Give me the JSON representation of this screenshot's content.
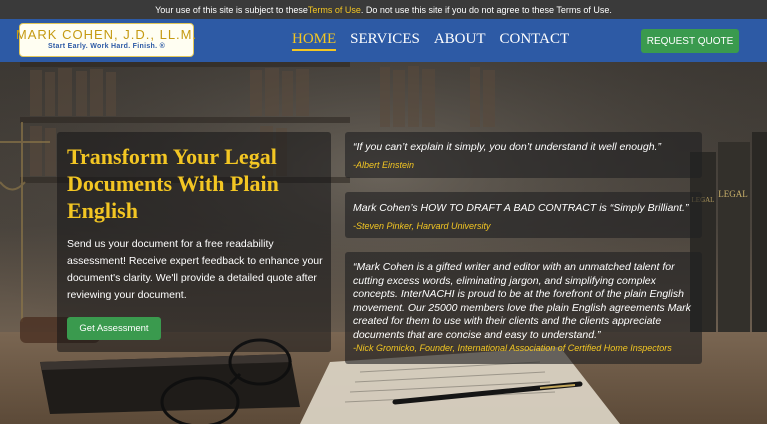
{
  "terms_bar": {
    "before": "Your use of this site is subject to these ",
    "link": "Terms of Use",
    "after": ". Do not use this site if you do not agree to these Terms of Use."
  },
  "logo": {
    "name": "MARK COHEN, J.D., LL.M.",
    "tagline": "Start Early. Work Hard. Finish. ®"
  },
  "nav": {
    "items": [
      "HOME",
      "SERVICES",
      "ABOUT",
      "CONTACT"
    ],
    "active": "HOME"
  },
  "cta": {
    "request_quote": "REQUEST QUOTE"
  },
  "hero": {
    "headline": "Transform Your Legal Documents With Plain English",
    "description": "Send us your document for a free readability assessment! Receive expert feedback to enhance your document's clarity. We'll provide a detailed quote after reviewing your document.",
    "button": "Get Assessment"
  },
  "quotes": [
    {
      "text": "“If you can’t explain it simply, you don’t understand it well enough.”",
      "author": "-Albert Einstein"
    },
    {
      "text": "Mark Cohen’s HOW TO DRAFT A BAD CONTRACT is “Simply Brilliant.”",
      "author": "-Steven Pinker, Harvard University"
    },
    {
      "text": "“Mark Cohen is a gifted writer and editor with an unmatched talent for cutting excess words, eliminating jargon, and simplifying complex concepts. InterNACHI is proud to be at the forefront of the plain English movement. Our 25000 members love the plain English agreements Mark created for them to use with their clients and the clients appreciate documents that are concise and easy to understand.”",
      "author": "-Nick Gromicko, Founder, International Association of Certified Home Inspectors"
    }
  ],
  "background_decor": {
    "book_spine_text": "LEGAL"
  },
  "colors": {
    "accent_gold": "#f3c623",
    "header_blue": "#2d5aa5",
    "cta_green": "#3a9a4e",
    "topbar": "#3a3a3a"
  }
}
